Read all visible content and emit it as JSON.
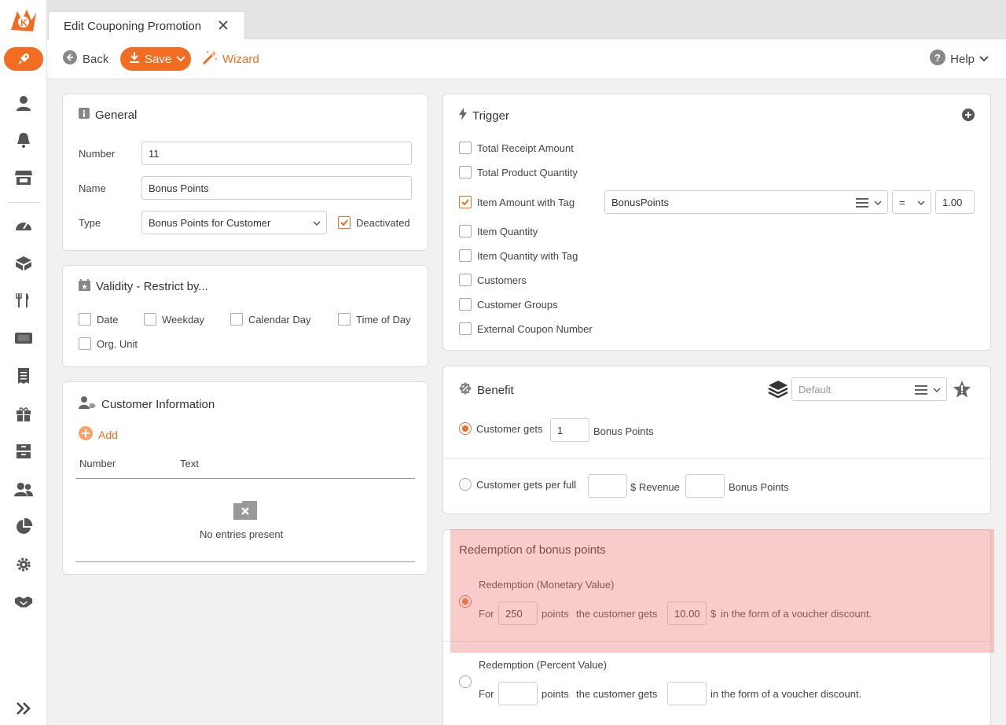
{
  "tab": {
    "title": "Edit Couponing Promotion"
  },
  "toolbar": {
    "back": "Back",
    "save": "Save",
    "wizard": "Wizard",
    "help": "Help"
  },
  "general": {
    "title": "General",
    "number_label": "Number",
    "number_value": "11",
    "name_label": "Name",
    "name_value": "Bonus Points",
    "type_label": "Type",
    "type_value": "Bonus Points for Customer",
    "deactivated_label": "Deactivated",
    "deactivated_checked": true
  },
  "validity": {
    "title": "Validity - Restrict by...",
    "options": [
      "Date",
      "Weekday",
      "Calendar Day",
      "Time of Day",
      "Org. Unit"
    ]
  },
  "customer_info": {
    "title": "Customer Information",
    "add_label": "Add",
    "columns": [
      "Number",
      "Text"
    ],
    "empty_text": "No entries present"
  },
  "trigger": {
    "title": "Trigger",
    "options": [
      "Total Receipt Amount",
      "Total Product Quantity",
      "Item Amount with Tag",
      "Item Quantity",
      "Item Quantity with Tag",
      "Customers",
      "Customer Groups",
      "External Coupon Number"
    ],
    "checked_option": "Item Amount with Tag",
    "tag_value": "BonusPoints",
    "operator": "=",
    "amount": "1.00"
  },
  "benefit": {
    "title": "Benefit",
    "layer_placeholder": "Default",
    "option1_prefix": "Customer gets",
    "option1_value": "1",
    "option1_suffix": "Bonus Points",
    "option2_prefix": "Customer gets per full",
    "option2_mid": "$ Revenue",
    "option2_suffix": "Bonus Points"
  },
  "redemption": {
    "title": "Redemption of bonus points",
    "monetary_title": "Redemption (Monetary Value)",
    "monetary_for": "For",
    "monetary_points": "250",
    "monetary_points_label": "points",
    "monetary_gets": "the customer gets",
    "monetary_value": "10.00",
    "monetary_currency": "$",
    "monetary_suffix": "in the form of a voucher discount.",
    "percent_title": "Redemption (Percent Value)",
    "percent_for": "For",
    "percent_points_label": "points",
    "percent_gets": "the customer gets",
    "percent_suffix": "in the form of a voucher discount."
  },
  "colors": {
    "accent": "#f26d21",
    "highlight": "#f5a3a3"
  }
}
